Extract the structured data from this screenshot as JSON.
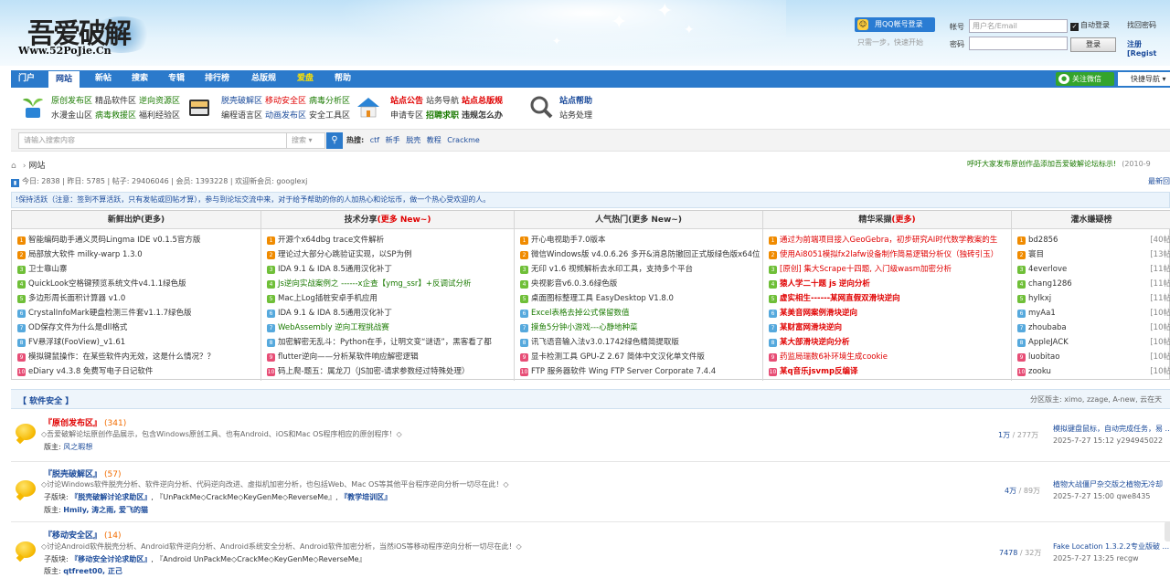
{
  "header": {
    "logo_text": "吾爱破解",
    "logo_url": "Www.52PoJie.Cn",
    "qq_login": "用QQ帐号登录",
    "qq_hint": "只需一步，快速开始",
    "account_label": "帐号",
    "account_placeholder": "用户名/Email",
    "password_label": "密码",
    "remember": "自动登录",
    "find_password": "找回密码",
    "login_button": "登录",
    "register": "注册[Regist"
  },
  "nav": {
    "items": [
      "门户",
      "网站",
      "新帖",
      "搜索",
      "专辑",
      "排行榜",
      "总版规",
      "爱盘",
      "帮助"
    ],
    "wechat": "关注微信",
    "quick_nav": "快捷导航"
  },
  "subnav": {
    "g1_r1": [
      "原创发布区",
      "精品软件区",
      "逆向资源区"
    ],
    "g1_r2": [
      "水漫金山区",
      "病毒救援区",
      "福利经验区"
    ],
    "g2_r1": [
      "脱壳破解区",
      "移动安全区",
      "病毒分析区"
    ],
    "g2_r2": [
      "编程语言区",
      "动画发布区",
      "安全工具区"
    ],
    "g3_r1": [
      "站点公告",
      "站务导航",
      "站点总版规"
    ],
    "g3_r2": [
      "申请专区",
      "招聘求职",
      "违规怎么办"
    ],
    "g4_r1": [
      "站点帮助"
    ],
    "g4_r2": [
      "站务处理"
    ]
  },
  "search": {
    "placeholder": "请输入搜索内容",
    "scope": "搜索",
    "hot_label": "热搜:",
    "hot": [
      "ctf",
      "新手",
      "脱壳",
      "教程",
      "Crackme"
    ]
  },
  "breadcrumb": {
    "home": "网站"
  },
  "notice": {
    "text": "呼吁大家发布原创作品添加吾爱破解论坛标示!",
    "date": "(2010-9"
  },
  "stats": {
    "text": "今日: 2838 | 昨日: 5785 | 帖子: 29406046 | 会员: 1393228 | 欢迎新会员: googlexj",
    "newest": "最新回"
  },
  "tip": "!保持活跃（注意：签到不算活跃，只有发帖或回帖才算），参与到论坛交流中来，对于给予帮助的你的人加热心和论坛币，做一个热心受欢迎的人。",
  "portal": {
    "c1": {
      "title": "新鲜出炉",
      "more": "(更多)",
      "items": [
        "智能编码助手通义灵码Lingma IDE v0.1.5官方版",
        "局部放大软件 milky-warp 1.3.0",
        "卫士靠山寨",
        "QuickLook空格键预览系统文件v4.1.1绿色版",
        "多边形周长面积计算器 v1.0",
        "CrystalInfoMark硬盘检测三件套v1.1.7绿色版",
        "OD保存文件为什么是dll格式",
        "FV悬浮球(FooView)_v1.61",
        "模拟键鼠操作：在某些软件内无效，这是什么情况？？",
        "eDiary v4.3.8 免费写电子日记软件"
      ]
    },
    "c2": {
      "title": "技术分享",
      "more": "(更多 New~)",
      "items": [
        "开源个x64dbg trace文件解析",
        "理论过大部分心跳验证实现，以SP为例",
        "IDA 9.1 & IDA 8.5通用汉化补丁",
        "Js逆向实战案例之 ------x企查【ymg_ssr】+反调试分析",
        "Mac上Log插桩安卓手机应用",
        "IDA 9.1 & IDA 8.5通用汉化补丁",
        "WebAssembly 逆向工程挑战赛",
        "加密解密无乱斗：Python在手，让明文变“谜语”，黑客看了都",
        "flutter逆向——分析某软件响应解密逻辑",
        "码上爬-题五：属龙刀（JS加密-请求参数经过特殊处理）"
      ]
    },
    "c3": {
      "title": "人气热门",
      "more": "(更多 New~)",
      "items": [
        "开心电视助手7.0版本",
        "微信Windows版 v4.0.6.26 多开&消息防撤回正式版绿色版x64位",
        "无印 v1.6 视频解析去水印工具，支持多个平台",
        "央视影音v6.0.3.6绿色版",
        "桌面图标整理工具 EasyDesktop V1.8.0",
        "Excel表格去掉公式保留数值",
        "摸鱼5分钟小游戏---心静地种菜",
        "讯飞语音输入法v3.0.1742绿色精简提取版",
        "显卡检测工具 GPU-Z 2.67 简体中文汉化单文件版",
        "FTP 服务器软件 Wing FTP Server Corporate 7.4.4"
      ]
    },
    "c4": {
      "title": "精华采撷",
      "more": "(更多)",
      "items": [
        "通过为前端项目接入GeoGebra，初步研究AI时代数学教案的生",
        "使用Ai8051模拟fx2lafw设备制作简易逻辑分析仪（独砖引玉）",
        "[原创] 集大Scrape十四题, 入门级wasm加密分析",
        "猿人学二十题 js 逆向分析",
        "虚实相生------某网直假双滑块逆向",
        "某美音网案例滑块逆向",
        "某财富网滑块逆向",
        "某大部滑块逆向分析",
        "药监局瑞数6补环境生成cookie",
        "某q音乐jsvmp反编译"
      ]
    },
    "c5": {
      "title": "灌水嫌疑榜",
      "users": [
        "bd2856",
        "寰目",
        "4everlove",
        "chang1286",
        "hylkxj",
        "myAa1",
        "zhoubaba",
        "AppleJACK",
        "luobitao",
        "zooku"
      ],
      "counts": [
        "[40帖",
        "[13帖",
        "[11帖",
        "[11帖",
        "[11帖",
        "[10帖",
        "[10帖",
        "[10帖",
        "[10帖",
        "[10帖"
      ]
    }
  },
  "forums": {
    "section": "【 软件安全 】",
    "moderators": "分区版主: ximo, zzage, A-new, 云在天",
    "f1": {
      "name": "『原创发布区』",
      "today": "(341)",
      "desc": "◇吾爱破解论坛原创作品展示，包含Windows原创工具、也有Android、iOS和Mac OS程序相应的原创程序！◇",
      "mod_label": "版主:",
      "mods": "风之暇想",
      "threads": "1万",
      "posts": "/ 277万",
      "last_title": "模拟键盘鼠标，自动完成任务，易 ...",
      "last_info": "2025-7-27 15:12 y294945022"
    },
    "f2": {
      "name": "『脱壳破解区』",
      "today": "(57)",
      "desc": "◇讨论Windows软件脱壳分析、软件逆向分析、代码逆向改进、虚拟机加密分析，也包括Web、Mac OS等其他平台程序逆向分析一切尽在此！◇",
      "sub_label": "子版块:",
      "sub1": "『脱壳破解讨论求助区』",
      "sub2": "『UnPackMe◇CrackMe◇KeyGenMe◇ReverseMe』",
      "sub3": "『教学培训区』",
      "mod_label": "版主:",
      "mods": "Hmily, 涛之雨, 爱飞的猫",
      "threads": "4万",
      "posts": "/ 89万",
      "last_title": "植物大战僵尸杂交版之植物无冷却",
      "last_info": "2025-7-27 15:00 qwe8435"
    },
    "f3": {
      "name": "『移动安全区』",
      "today": "(14)",
      "desc": "◇讨论Android软件脱壳分析、Android软件逆向分析、Android系统安全分析、Android软件加密分析，当然iOS等移动程序逆向分析一切尽在此！◇",
      "sub_label": "子版块:",
      "sub1": "『移动安全讨论求助区』",
      "sub2": "『Android UnPackMe◇CrackMe◇KeyGenMe◇ReverseMe』",
      "mod_label": "版主:",
      "mods": "qtfreet00, 正己",
      "threads": "7478",
      "posts": "/ 32万",
      "last_title": "Fake Location 1.3.2.2专业版破 ...",
      "last_info": "2025-7-27 13:25 recgw"
    }
  }
}
